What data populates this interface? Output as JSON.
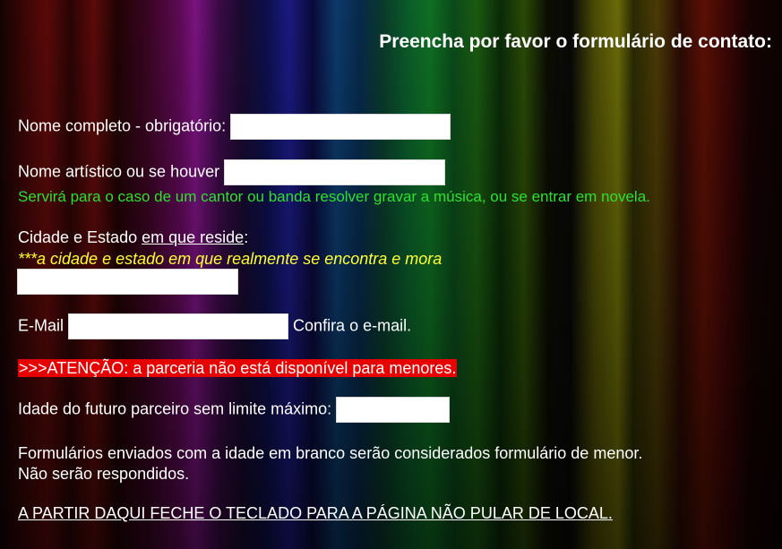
{
  "form": {
    "title": "Preencha por favor o formulário de contato:",
    "full_name_label": "Nome completo - obrigatório:",
    "artistic_name_label": "Nome artístico ou se houver",
    "artistic_note": "Servirá para o caso de um cantor ou banda resolver gravar a música, ou se entrar em novela.",
    "city_label_prefix": "Cidade e Estado",
    "city_label_link": "em que reside",
    "city_label_suffix": ":",
    "city_note": "***a cidade e estado em que realmente se encontra e mora",
    "email_label": "E-Mail",
    "email_confirm_label": "Confira o e-mail.",
    "alert_text": ">>>ATENÇÃO: a parceria não está disponível para menores.",
    "age_label": "Idade do futuro parceiro sem limite máximo:",
    "notice_line1": "Formulários enviados com a idade em branco serão considerados formulário de menor.",
    "notice_line2": "Não serão respondidos.",
    "keyboard_note": "A PARTIR DAQUI FECHE O TECLADO PARA A PÁGINA NÃO PULAR DE LOCAL.",
    "full_name_value": "",
    "artistic_name_value": "",
    "city_value": "",
    "email_value": "",
    "age_value": ""
  }
}
